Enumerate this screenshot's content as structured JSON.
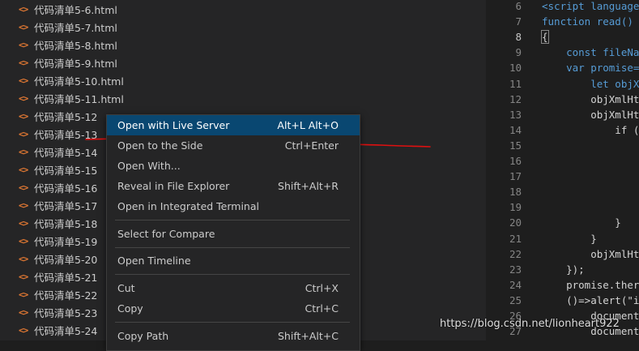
{
  "explorer": {
    "files": [
      "代码清单5-6.html",
      "代码清单5-7.html",
      "代码清单5-8.html",
      "代码清单5-9.html",
      "代码清单5-10.html",
      "代码清单5-11.html",
      "代码清单5-12",
      "代码清单5-13",
      "代码清单5-14",
      "代码清单5-15",
      "代码清单5-16",
      "代码清单5-17",
      "代码清单5-18",
      "代码清单5-19",
      "代码清单5-20",
      "代码清单5-21",
      "代码清单5-22",
      "代码清单5-23",
      "代码清单5-24"
    ],
    "file_icon_glyph": "<>",
    "file_icon_color": "#e37933"
  },
  "editor": {
    "active_line": "8",
    "lines": [
      {
        "n": "6",
        "code": "<script language"
      },
      {
        "n": "7",
        "code": "function read()"
      },
      {
        "n": "8",
        "code": "{"
      },
      {
        "n": "9",
        "code": "    const fileNa"
      },
      {
        "n": "10",
        "code": "    var promise="
      },
      {
        "n": "11",
        "code": "        let objX"
      },
      {
        "n": "12",
        "code": "        objXmlHt"
      },
      {
        "n": "13",
        "code": "        objXmlHt"
      },
      {
        "n": "14",
        "code": "            if ("
      },
      {
        "n": "15",
        "code": ""
      },
      {
        "n": "16",
        "code": ""
      },
      {
        "n": "17",
        "code": ""
      },
      {
        "n": "18",
        "code": ""
      },
      {
        "n": "19",
        "code": ""
      },
      {
        "n": "20",
        "code": "            }"
      },
      {
        "n": "21",
        "code": "        }"
      },
      {
        "n": "22",
        "code": "        objXmlHt"
      },
      {
        "n": "23",
        "code": "    });"
      },
      {
        "n": "24",
        "code": "    promise.ther"
      },
      {
        "n": "25",
        "code": "    ()=>alert(\"i"
      },
      {
        "n": "26",
        "code": "        document"
      },
      {
        "n": "27",
        "code": "        document"
      }
    ]
  },
  "context_menu": {
    "items": [
      {
        "label": "Open with Live Server",
        "shortcut": "Alt+L Alt+O",
        "highlighted": true
      },
      {
        "label": "Open to the Side",
        "shortcut": "Ctrl+Enter"
      },
      {
        "label": "Open With...",
        "shortcut": ""
      },
      {
        "label": "Reveal in File Explorer",
        "shortcut": "Shift+Alt+R"
      },
      {
        "label": "Open in Integrated Terminal",
        "shortcut": ""
      },
      {
        "label": "Select for Compare",
        "shortcut": ""
      },
      {
        "label": "Open Timeline",
        "shortcut": ""
      },
      {
        "label": "Cut",
        "shortcut": "Ctrl+X"
      },
      {
        "label": "Copy",
        "shortcut": "Ctrl+C"
      },
      {
        "label": "Copy Path",
        "shortcut": "Shift+Alt+C"
      }
    ]
  },
  "watermark": "https://blog.csdn.net/lionheart922",
  "colors": {
    "highlight": "#094771",
    "annotation": "#e01010",
    "sidebar_bg": "#252526",
    "editor_bg": "#1e1e1e"
  }
}
